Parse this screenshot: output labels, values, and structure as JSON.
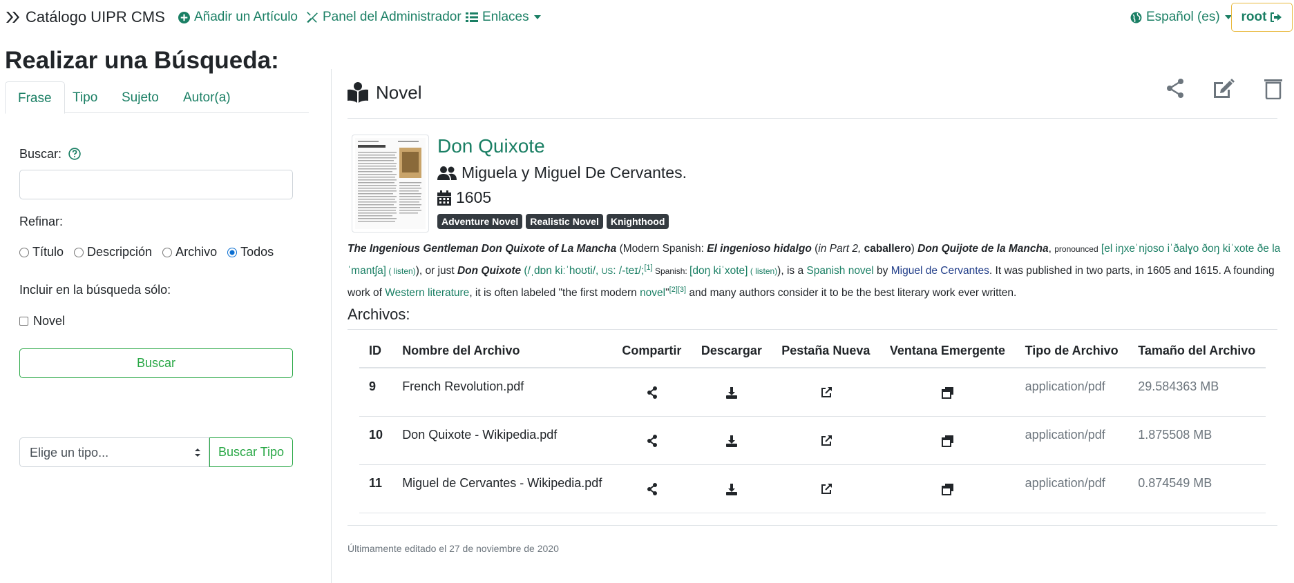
{
  "navbar": {
    "brand": "Catálogo UIPR CMS",
    "add_article": "Añadir un Artículo",
    "admin_panel": "Panel del Administrador",
    "links": "Enlaces",
    "language": "Español (es)",
    "user": "root"
  },
  "search": {
    "title": "Realizar una Búsqueda:",
    "tabs": [
      "Frase",
      "Tipo",
      "Sujeto",
      "Autor(a)"
    ],
    "active_tab": "Frase",
    "search_label": "Buscar:",
    "search_value": "",
    "refine_label": "Refinar:",
    "refine_options": [
      "Título",
      "Descripción",
      "Archivo",
      "Todos"
    ],
    "refine_selected": "Todos",
    "include_label": "Incluir en la búsqueda sólo:",
    "include_options": [
      "Novel"
    ],
    "search_button": "Buscar",
    "type_select_placeholder": "Elige un tipo...",
    "type_search_button": "Buscar Tipo"
  },
  "item": {
    "category": "Novel",
    "title": "Don Quixote",
    "authors": "Miguela y Miguel De Cervantes.",
    "year": "1605",
    "tags": [
      "Adventure Novel",
      "Realistic Novel",
      "Knighthood"
    ],
    "description": {
      "p1": "The Ingenious Gentleman Don Quixote of La Mancha",
      "p2": " (Modern Spanish: ",
      "p3": "El ingenioso hidalgo",
      "p4": " (",
      "p5": "in Part 2,",
      "p6": " caballero",
      "p7": ") ",
      "p8": "Don Quijote de la Mancha",
      "p9": ", ",
      "p10": "pronounced",
      "p11": " [el iŋxeˈnjoso iˈðalɣo ðoŋ kiˈxote ðe la ˈmantʃa]",
      "p12": " ( listen)",
      "p13": "), or just ",
      "p14": "Don Quixote",
      "p15": " (/ˌdɒn kiːˈhoʊti/, ",
      "p16": "US",
      "p17": ": /-teɪ/;",
      "p18": "[1]",
      "p19": " Spanish: ",
      "p20": "[doŋ kiˈxote]",
      "p21": " ( listen)",
      "p22": "), is a ",
      "p23": "Spanish novel",
      "p24": " by ",
      "p25": "Miguel de Cervantes",
      "p26": ". It was published in two parts, in 1605 and 1615. A founding work of ",
      "p27": "Western literature",
      "p28": ", it is often labeled \"the first modern ",
      "p29": "novel",
      "p30": "\"",
      "p31": "[2][3]",
      "p32": " and many authors consider it to be the best literary work ever written."
    },
    "files_title": "Archivos:",
    "files_columns": [
      "ID",
      "Nombre del Archivo",
      "Compartir",
      "Descargar",
      "Pestaña Nueva",
      "Ventana Emergente",
      "Tipo de Archivo",
      "Tamaño del Archivo"
    ],
    "files": [
      {
        "id": "9",
        "name": "French Revolution.pdf",
        "type": "application/pdf",
        "size": "29.584363 MB"
      },
      {
        "id": "10",
        "name": "Don Quixote - Wikipedia.pdf",
        "type": "application/pdf",
        "size": "1.875508 MB"
      },
      {
        "id": "11",
        "name": "Miguel de Cervantes - Wikipedia.pdf",
        "type": "application/pdf",
        "size": "0.874549 MB"
      }
    ],
    "last_edited": "Últimamente editado el 27 de noviembre de 2020"
  },
  "colors": {
    "accent": "#1a7f64",
    "success": "#28a745",
    "warning_border": "#e8b83a",
    "badge": "#343a40"
  }
}
